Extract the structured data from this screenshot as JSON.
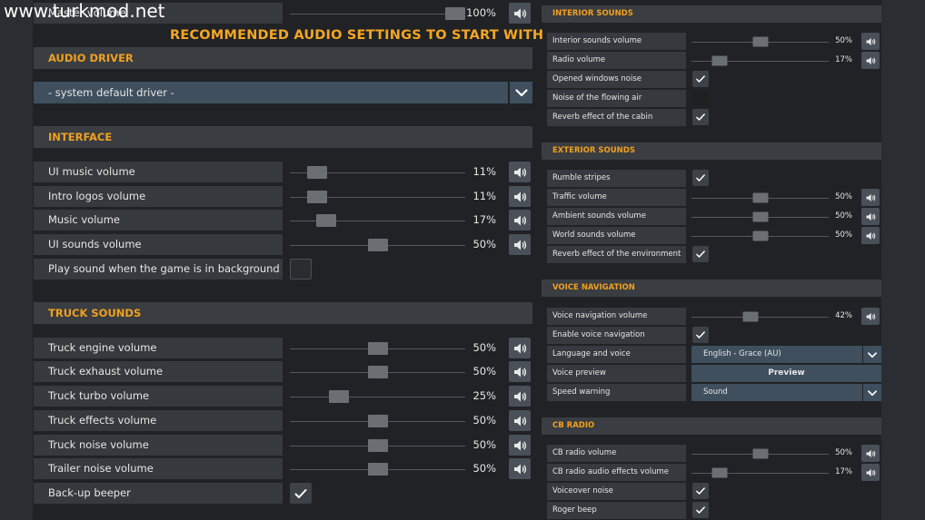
{
  "watermark": "www.turkmod.net",
  "recommended_title": "RECOMMENDED AUDIO SETTINGS TO START WITH",
  "top": {
    "label": "Master volume",
    "value": 100,
    "value_text": "100%"
  },
  "audio_driver": {
    "header": "AUDIO DRIVER",
    "selected": "- system default driver -"
  },
  "interface": {
    "header": "INTERFACE",
    "rows": [
      {
        "label": "UI music volume",
        "value": 11,
        "value_text": "11%"
      },
      {
        "label": "Intro logos volume",
        "value": 11,
        "value_text": "11%"
      },
      {
        "label": "Music volume",
        "value": 17,
        "value_text": "17%"
      },
      {
        "label": "UI sounds volume",
        "value": 50,
        "value_text": "50%"
      }
    ],
    "background_sound": {
      "label": "Play sound when the game is in background",
      "checked": false
    }
  },
  "truck_sounds": {
    "header": "TRUCK SOUNDS",
    "rows": [
      {
        "label": "Truck engine volume",
        "value": 50,
        "value_text": "50%"
      },
      {
        "label": "Truck exhaust volume",
        "value": 50,
        "value_text": "50%"
      },
      {
        "label": "Truck turbo volume",
        "value": 25,
        "value_text": "25%"
      },
      {
        "label": "Truck effects volume",
        "value": 50,
        "value_text": "50%"
      },
      {
        "label": "Truck noise volume",
        "value": 50,
        "value_text": "50%"
      },
      {
        "label": "Trailer noise volume",
        "value": 50,
        "value_text": "50%"
      }
    ],
    "backup_beeper": {
      "label": "Back-up beeper",
      "checked": true
    }
  },
  "interior_sounds": {
    "header": "INTERIOR SOUNDS",
    "interior_volume": {
      "label": "Interior sounds volume",
      "value": 50,
      "value_text": "50%"
    },
    "radio_volume": {
      "label": "Radio volume",
      "value": 17,
      "value_text": "17%"
    },
    "opened_windows": {
      "label": "Opened windows noise",
      "checked": true
    },
    "flowing_air": {
      "label": "Noise of the flowing air",
      "checked": false
    },
    "reverb_cabin": {
      "label": "Reverb effect of the cabin",
      "checked": true
    }
  },
  "exterior_sounds": {
    "header": "EXTERIOR SOUNDS",
    "rumble_stripes": {
      "label": "Rumble stripes",
      "checked": true
    },
    "traffic": {
      "label": "Traffic volume",
      "value": 50,
      "value_text": "50%"
    },
    "ambient": {
      "label": "Ambient sounds volume",
      "value": 50,
      "value_text": "50%"
    },
    "world": {
      "label": "World sounds volume",
      "value": 50,
      "value_text": "50%"
    },
    "reverb_env": {
      "label": "Reverb effect of the environment",
      "checked": true
    }
  },
  "voice_navigation": {
    "header": "VOICE NAVIGATION",
    "volume": {
      "label": "Voice navigation volume",
      "value": 42,
      "value_text": "42%"
    },
    "enable": {
      "label": "Enable voice navigation",
      "checked": true
    },
    "language": {
      "label": "Language and voice",
      "selected": "English - Grace (AU)"
    },
    "preview": {
      "label": "Voice preview",
      "button": "Preview"
    },
    "speed_warning": {
      "label": "Speed warning",
      "selected": "Sound"
    }
  },
  "cb_radio": {
    "header": "CB RADIO",
    "volume": {
      "label": "CB radio volume",
      "value": 50,
      "value_text": "50%"
    },
    "effects": {
      "label": "CB radio audio effects volume",
      "value": 17,
      "value_text": "17%"
    },
    "voiceover": {
      "label": "Voiceover noise",
      "checked": true
    },
    "roger_beep": {
      "label": "Roger beep",
      "checked": true
    }
  },
  "colors": {
    "accent": "#f0a020",
    "panel": "#36393d",
    "header": "#3a3d41",
    "dropdown": "#3f4f5e",
    "speaker_button": "#4a5058"
  },
  "icons": {
    "speaker": "speaker-icon",
    "check": "checkmark-icon",
    "dropdown": "chevron-down-icon"
  }
}
